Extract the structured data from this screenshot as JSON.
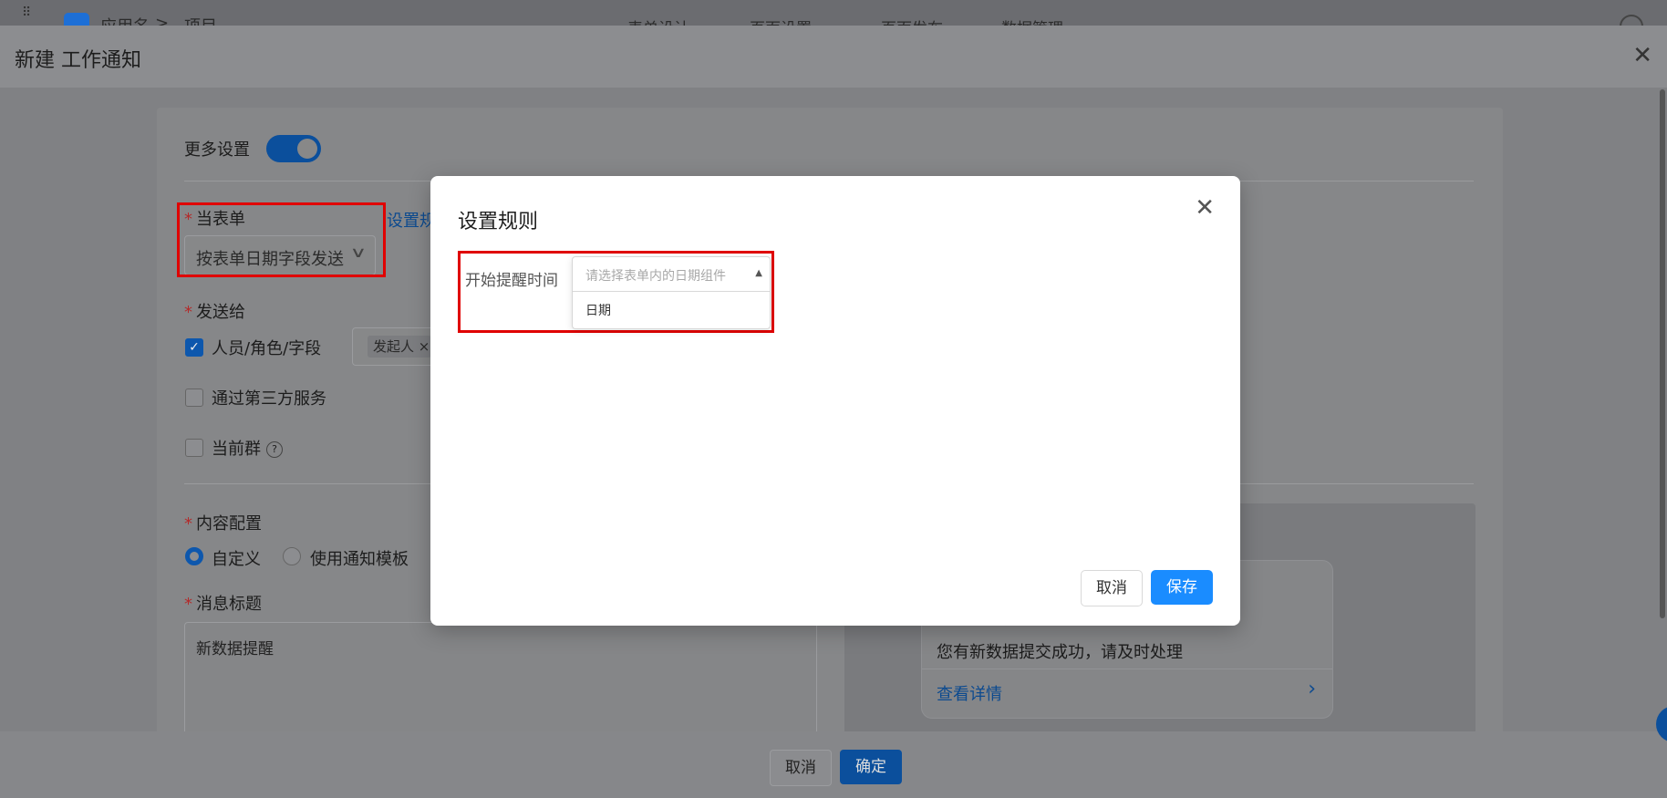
{
  "appbar": {
    "crumb_app": "应用名",
    "crumb_project": "项目",
    "nav": [
      "表单设计",
      "页面设置",
      "页面发布",
      "数据管理"
    ]
  },
  "drawer": {
    "title": "新建 工作通知"
  },
  "form": {
    "more_settings_label": "更多设置",
    "more_settings_on": true,
    "trigger_label": "当表单",
    "trigger_value": "按表单日期字段发送",
    "set_rule_link": "设置规",
    "send_to_label": "发送给",
    "recipients": {
      "option1": "人员/角色/字段",
      "option1_checked": true,
      "tag": "发起人",
      "tag_close": "×",
      "option2": "通过第三方服务",
      "option2_checked": false,
      "option3": "当前群",
      "option3_checked": false
    },
    "content_label": "内容配置",
    "content_options": [
      "自定义",
      "使用通知模板"
    ],
    "content_selected": "自定义",
    "msg_title_label": "消息标题",
    "msg_title_value": "新数据提醒"
  },
  "preview": {
    "message": "您有新数据提交成功，请及时处理",
    "detail_link": "查看详情"
  },
  "footer": {
    "cancel": "取消",
    "confirm": "确定"
  },
  "modal": {
    "title": "设置规则",
    "field_label": "开始提醒时间",
    "select_placeholder": "请选择表单内的日期组件",
    "options": [
      "日期"
    ],
    "cancel": "取消",
    "save": "保存"
  },
  "colors": {
    "primary": "#1a8cff",
    "highlight_box": "#e00000",
    "overlay": "#808184"
  }
}
